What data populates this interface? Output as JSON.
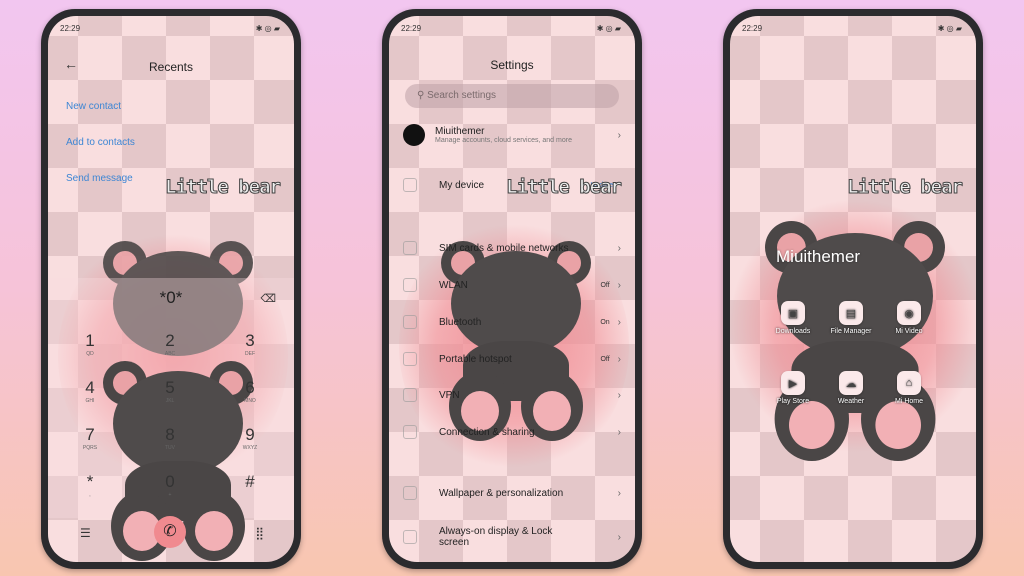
{
  "status": {
    "time": "22:29",
    "icons": "✱ ◎ ▰"
  },
  "watermark": "Little bear",
  "dialer": {
    "title": "Recents",
    "back_icon": "arrow-left-icon",
    "links": [
      "New contact",
      "Add to contacts",
      "Send message"
    ],
    "input": "*0*",
    "keys": [
      {
        "d": "1",
        "l": "QD"
      },
      {
        "d": "2",
        "l": "ABC"
      },
      {
        "d": "3",
        "l": "DEF"
      },
      {
        "d": "4",
        "l": "GHI"
      },
      {
        "d": "5",
        "l": "JKL"
      },
      {
        "d": "6",
        "l": "MNO"
      },
      {
        "d": "7",
        "l": "PQRS"
      },
      {
        "d": "8",
        "l": "TUV"
      },
      {
        "d": "9",
        "l": "WXYZ"
      },
      {
        "d": "*",
        "l": ","
      },
      {
        "d": "0",
        "l": "+"
      },
      {
        "d": "#",
        "l": ""
      }
    ],
    "menu_icon": "☰",
    "keypad_icon": "⣿",
    "call_icon": "✆",
    "call_color": "#f08a8f"
  },
  "settings": {
    "title": "Settings",
    "search_placeholder": "Search settings",
    "account": {
      "name": "Miuithemer",
      "sub": "Manage accounts, cloud services, and more"
    },
    "my_device": {
      "label": "My device",
      "badge": "Update"
    },
    "items": [
      {
        "label": "SIM cards & mobile networks",
        "value": ""
      },
      {
        "label": "WLAN",
        "value": "Off"
      },
      {
        "label": "Bluetooth",
        "value": "On"
      },
      {
        "label": "Portable hotspot",
        "value": "Off"
      },
      {
        "label": "VPN",
        "value": ""
      },
      {
        "label": "Connection & sharing",
        "value": ""
      }
    ],
    "items2": [
      {
        "label": "Wallpaper & personalization"
      },
      {
        "label": "Always-on display & Lock screen"
      }
    ]
  },
  "home": {
    "title": "Miuithemer",
    "apps": [
      {
        "label": "Downloads",
        "icon": "▣"
      },
      {
        "label": "File Manager",
        "icon": "▤"
      },
      {
        "label": "Mi Video",
        "icon": "◉"
      },
      {
        "label": "Play Store",
        "icon": "▶"
      },
      {
        "label": "Weather",
        "icon": "☁"
      },
      {
        "label": "Mi Home",
        "icon": "⌂"
      }
    ]
  }
}
